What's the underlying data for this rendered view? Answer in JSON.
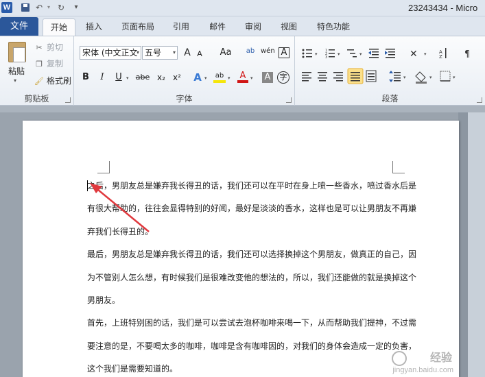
{
  "app": {
    "logo": "W",
    "title": "23243434 - Micro"
  },
  "quick_access": {
    "undo": "↶",
    "redo": "↻",
    "customize": "▾"
  },
  "tabs": {
    "file": "文件",
    "items": [
      "开始",
      "插入",
      "页面布局",
      "引用",
      "邮件",
      "审阅",
      "视图",
      "特色功能"
    ]
  },
  "clipboard": {
    "paste": "粘贴",
    "cut": "剪切",
    "copy": "复制",
    "format_painter": "格式刷",
    "group_label": "剪贴板"
  },
  "font": {
    "font_name": "宋体 (中文正文",
    "font_size": "五号",
    "grow": "A",
    "shrink": "A",
    "change_case": "Aa",
    "clear_format": "ab",
    "phonetic": "wén",
    "char_border": "A",
    "bold": "B",
    "italic": "I",
    "underline": "U",
    "strike": "abe",
    "subscript": "x₂",
    "superscript": "x²",
    "text_effects": "A",
    "highlight": "ab",
    "font_color": "A",
    "char_shading": "A",
    "enclose": "字",
    "group_label": "字体"
  },
  "paragraph": {
    "group_label": "段落"
  },
  "document": {
    "paragraphs": [
      "之后，男朋友总是嫌弃我长得丑的话，我们还可以在平时在身上喷一些香水，喷过香水后是",
      "有很大帮助的，往往会显得特别的好闻，最好是淡淡的香水，这样也是可以让男朋友不再嫌",
      "弃我们长得丑的。",
      "最后，男朋友总是嫌弃我长得丑的话，我们还可以选择换掉这个男朋友，做真正的自己，因",
      "为不管别人怎么想，有时候我们是很难改变他的想法的，所以，我们还能做的就是换掉这个",
      "男朋友。",
      "首先，上班特别困的话，我们是可以尝试去泡杯咖啡来喝一下，从而帮助我们提神，不过需",
      "要注意的是，不要喝太多的咖啡，咖啡是含有咖啡因的，对我们的身体会造成一定的负害，",
      "这个我们是需要知道的。"
    ]
  },
  "watermark": {
    "main": "经验",
    "sub": "jingyan.baidu.com"
  },
  "colors": {
    "file_tab": "#2b579a",
    "arrow": "#e0393e",
    "workspace": "#9aa3ad"
  }
}
